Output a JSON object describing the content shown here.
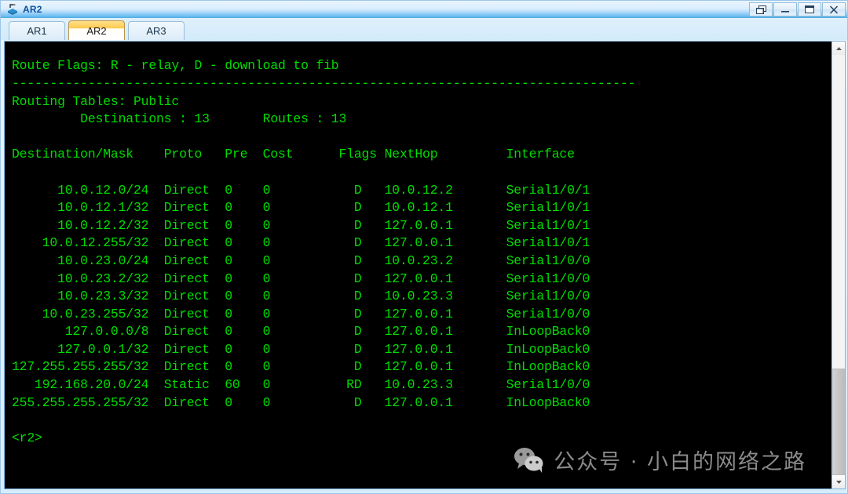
{
  "window": {
    "title": "AR2",
    "app_icon": "router-icon",
    "buttons": [
      {
        "name": "restore-button",
        "glyph": "restore-icon"
      },
      {
        "name": "minimize-button",
        "glyph": "minimize-icon"
      },
      {
        "name": "maximize-button",
        "glyph": "maximize-icon"
      },
      {
        "name": "close-button",
        "glyph": "close-icon"
      }
    ]
  },
  "tabs": [
    {
      "label": "AR1",
      "active": false
    },
    {
      "label": "AR2",
      "active": true
    },
    {
      "label": "AR3",
      "active": false
    }
  ],
  "terminal": {
    "route_flags_line": "Route Flags: R - relay, D - download to fib",
    "separator": "----------------------------------------------------------------------------------",
    "routing_tables_line": "Routing Tables: Public",
    "summary_line": "         Destinations : 13       Routes : 13",
    "headers": {
      "destination": "Destination/Mask",
      "proto": "Proto",
      "pre": "Pre",
      "cost": "Cost",
      "flags": "Flags",
      "nexthop": "NextHop",
      "interface": "Interface"
    },
    "header_line": "Destination/Mask    Proto   Pre  Cost      Flags NextHop         Interface",
    "rows": [
      {
        "destination": "10.0.12.0/24",
        "proto": "Direct",
        "pre": "0",
        "cost": "0",
        "flags": "D",
        "nexthop": "10.0.12.2",
        "interface": "Serial1/0/1"
      },
      {
        "destination": "10.0.12.1/32",
        "proto": "Direct",
        "pre": "0",
        "cost": "0",
        "flags": "D",
        "nexthop": "10.0.12.1",
        "interface": "Serial1/0/1"
      },
      {
        "destination": "10.0.12.2/32",
        "proto": "Direct",
        "pre": "0",
        "cost": "0",
        "flags": "D",
        "nexthop": "127.0.0.1",
        "interface": "Serial1/0/1"
      },
      {
        "destination": "10.0.12.255/32",
        "proto": "Direct",
        "pre": "0",
        "cost": "0",
        "flags": "D",
        "nexthop": "127.0.0.1",
        "interface": "Serial1/0/1"
      },
      {
        "destination": "10.0.23.0/24",
        "proto": "Direct",
        "pre": "0",
        "cost": "0",
        "flags": "D",
        "nexthop": "10.0.23.2",
        "interface": "Serial1/0/0"
      },
      {
        "destination": "10.0.23.2/32",
        "proto": "Direct",
        "pre": "0",
        "cost": "0",
        "flags": "D",
        "nexthop": "127.0.0.1",
        "interface": "Serial1/0/0"
      },
      {
        "destination": "10.0.23.3/32",
        "proto": "Direct",
        "pre": "0",
        "cost": "0",
        "flags": "D",
        "nexthop": "10.0.23.3",
        "interface": "Serial1/0/0"
      },
      {
        "destination": "10.0.23.255/32",
        "proto": "Direct",
        "pre": "0",
        "cost": "0",
        "flags": "D",
        "nexthop": "127.0.0.1",
        "interface": "Serial1/0/0"
      },
      {
        "destination": "127.0.0.0/8",
        "proto": "Direct",
        "pre": "0",
        "cost": "0",
        "flags": "D",
        "nexthop": "127.0.0.1",
        "interface": "InLoopBack0"
      },
      {
        "destination": "127.0.0.1/32",
        "proto": "Direct",
        "pre": "0",
        "cost": "0",
        "flags": "D",
        "nexthop": "127.0.0.1",
        "interface": "InLoopBack0"
      },
      {
        "destination": "127.255.255.255/32",
        "proto": "Direct",
        "pre": "0",
        "cost": "0",
        "flags": "D",
        "nexthop": "127.0.0.1",
        "interface": "InLoopBack0"
      },
      {
        "destination": "192.168.20.0/24",
        "proto": "Static",
        "pre": "60",
        "cost": "0",
        "flags": "RD",
        "nexthop": "10.0.23.3",
        "interface": "Serial1/0/0"
      },
      {
        "destination": "255.255.255.255/32",
        "proto": "Direct",
        "pre": "0",
        "cost": "0",
        "flags": "D",
        "nexthop": "127.0.0.1",
        "interface": "InLoopBack0"
      }
    ],
    "prompt": "<r2>",
    "destinations_count": "13",
    "routes_count": "13",
    "text_color": "#00dd00",
    "background_color": "#000000"
  },
  "watermark": {
    "text": "公众号 · 小白的网络之路",
    "logo": "wechat-icon",
    "color": "#8a8a8a"
  }
}
